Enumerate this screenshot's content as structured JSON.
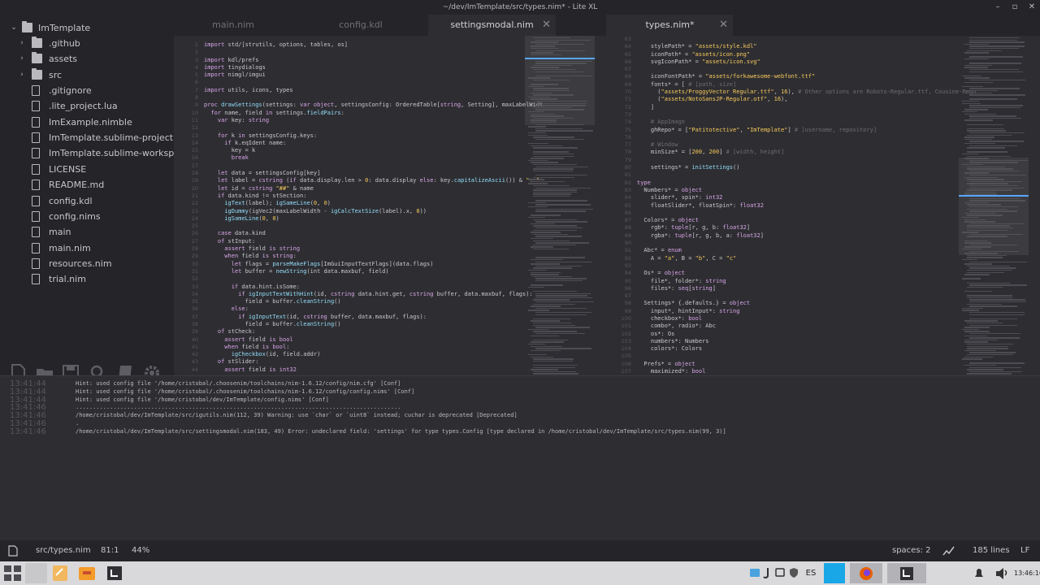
{
  "window": {
    "title": "~/dev/ImTemplate/src/types.nim* - Lite XL"
  },
  "sidebar": {
    "project": "ImTemplate",
    "items": [
      {
        "label": ".github",
        "type": "folder"
      },
      {
        "label": "assets",
        "type": "folder"
      },
      {
        "label": "src",
        "type": "folder"
      },
      {
        "label": ".gitignore",
        "type": "file"
      },
      {
        "label": ".lite_project.lua",
        "type": "file"
      },
      {
        "label": "ImExample.nimble",
        "type": "file"
      },
      {
        "label": "ImTemplate.sublime-project",
        "type": "file"
      },
      {
        "label": "ImTemplate.sublime-workspace",
        "type": "file"
      },
      {
        "label": "LICENSE",
        "type": "file"
      },
      {
        "label": "README.md",
        "type": "file"
      },
      {
        "label": "config.kdl",
        "type": "file"
      },
      {
        "label": "config.nims",
        "type": "file"
      },
      {
        "label": "main",
        "type": "file"
      },
      {
        "label": "main.nim",
        "type": "file"
      },
      {
        "label": "resources.nim",
        "type": "file"
      },
      {
        "label": "trial.nim",
        "type": "file"
      }
    ],
    "tools": [
      "new-file-icon",
      "open-folder-icon",
      "save-icon",
      "search-icon",
      "book-icon",
      "gear-icon"
    ]
  },
  "left_pane": {
    "tabs": [
      {
        "label": "main.nim",
        "active": false
      },
      {
        "label": "config.kdl",
        "active": false
      },
      {
        "label": "settingsmodal.nim",
        "active": true
      }
    ],
    "lines": [
      {
        "n": "1",
        "t": "import std/[strutils, options, tables, os]"
      },
      {
        "n": "2",
        "t": ""
      },
      {
        "n": "3",
        "t": "import kdl/prefs"
      },
      {
        "n": "4",
        "t": "import tinydialogs"
      },
      {
        "n": "5",
        "t": "import nimgl/imgui"
      },
      {
        "n": "6",
        "t": ""
      },
      {
        "n": "7",
        "t": "import utils, icons, types"
      },
      {
        "n": "8",
        "t": ""
      },
      {
        "n": "9",
        "t": "proc drawSettings(settings: var object, settingsConfig: OrderedTable[string, Setting], maxLabelWidt"
      },
      {
        "n": "10",
        "t": "  for name, field in settings.fieldPairs:"
      },
      {
        "n": "11",
        "t": "    var key: string"
      },
      {
        "n": "12",
        "t": ""
      },
      {
        "n": "13",
        "t": "    for k in settingsConfig.keys:"
      },
      {
        "n": "14",
        "t": "      if k.eqIdent name:"
      },
      {
        "n": "15",
        "t": "        key = k"
      },
      {
        "n": "16",
        "t": "        break"
      },
      {
        "n": "17",
        "t": ""
      },
      {
        "n": "18",
        "t": "    let data = settingsConfig[key]"
      },
      {
        "n": "19",
        "t": "    let label = cstring (if data.display.len > 0: data.display else: key.capitalizeAscii()) & \": \""
      },
      {
        "n": "20",
        "t": "    let id = cstring \"##\" & name"
      },
      {
        "n": "21",
        "t": "    if data.kind != stSection:"
      },
      {
        "n": "22",
        "t": "      igText(label); igSameLine(0, 0)"
      },
      {
        "n": "23",
        "t": "      igDummy(igVec2(maxLabelWidth - igCalcTextSize(label).x, 0))"
      },
      {
        "n": "24",
        "t": "      igSameLine(0, 0)"
      },
      {
        "n": "25",
        "t": ""
      },
      {
        "n": "26",
        "t": "    case data.kind"
      },
      {
        "n": "27",
        "t": "    of stInput:"
      },
      {
        "n": "28",
        "t": "      assert field is string"
      },
      {
        "n": "29",
        "t": "      when field is string:"
      },
      {
        "n": "30",
        "t": "        let flags = parseMakeFlags[ImGuiInputTextFlags](data.flags)"
      },
      {
        "n": "31",
        "t": "        let buffer = newString(int data.maxbuf, field)"
      },
      {
        "n": "32",
        "t": ""
      },
      {
        "n": "33",
        "t": "        if data.hint.isSome:"
      },
      {
        "n": "34",
        "t": "          if igInputTextWithHint(id, cstring data.hint.get, cstring buffer, data.maxbuf, flags):"
      },
      {
        "n": "35",
        "t": "            field = buffer.cleanString()"
      },
      {
        "n": "36",
        "t": "        else:"
      },
      {
        "n": "37",
        "t": "          if igInputText(id, cstring buffer, data.maxbuf, flags):"
      },
      {
        "n": "38",
        "t": "            field = buffer.cleanString()"
      },
      {
        "n": "39",
        "t": "    of stCheck:"
      },
      {
        "n": "40",
        "t": "      assert field is bool"
      },
      {
        "n": "41",
        "t": "      when field is bool:"
      },
      {
        "n": "42",
        "t": "        igCheckbox(id, field.addr)"
      },
      {
        "n": "43",
        "t": "    of stSlider:"
      },
      {
        "n": "44",
        "t": "      assert field is int32"
      }
    ]
  },
  "right_pane": {
    "tabs": [
      {
        "label": "types.nim*",
        "active": true
      }
    ],
    "lines": [
      {
        "n": "63",
        "t": ""
      },
      {
        "n": "64",
        "t": "    stylePath* = \"assets/style.kdl\""
      },
      {
        "n": "65",
        "t": "    iconPath* = \"assets/icon.png\""
      },
      {
        "n": "66",
        "t": "    svgIconPath* = \"assets/icon.svg\""
      },
      {
        "n": "67",
        "t": ""
      },
      {
        "n": "68",
        "t": "    iconFontPath* = \"assets/forkawesome-webfont.ttf\""
      },
      {
        "n": "69",
        "t": "    fonts* = [ # [path, size]"
      },
      {
        "n": "70",
        "t": "      (\"assets/ProggyVector Regular.ttf\", 16), # Other options are Roboto-Regular.ttf, Cousine-Regu"
      },
      {
        "n": "71",
        "t": "      (\"assets/NotoSansJP-Regular.otf\", 16),"
      },
      {
        "n": "72",
        "t": "    ]"
      },
      {
        "n": "73",
        "t": ""
      },
      {
        "n": "74",
        "t": "    # AppImage"
      },
      {
        "n": "75",
        "t": "    ghRepo* = [\"Patitotective\", \"ImTemplate\"] # [username, repository]"
      },
      {
        "n": "76",
        "t": ""
      },
      {
        "n": "77",
        "t": "    # Window"
      },
      {
        "n": "78",
        "t": "    minSize* = [200, 200] # [width, height]"
      },
      {
        "n": "79",
        "t": ""
      },
      {
        "n": "80",
        "t": "    settings* = initSettings()"
      },
      {
        "n": "81",
        "t": ""
      },
      {
        "n": "82",
        "t": "type"
      },
      {
        "n": "83",
        "t": "  Numbers* = object"
      },
      {
        "n": "84",
        "t": "    slider*, spin*: int32"
      },
      {
        "n": "85",
        "t": "    floatSlider*, floatSpin*: float32"
      },
      {
        "n": "86",
        "t": ""
      },
      {
        "n": "87",
        "t": "  Colors* = object"
      },
      {
        "n": "88",
        "t": "    rgb*: tuple[r, g, b: float32]"
      },
      {
        "n": "89",
        "t": "    rgba*: tuple[r, g, b, a: float32]"
      },
      {
        "n": "90",
        "t": ""
      },
      {
        "n": "91",
        "t": "  Abc* = enum"
      },
      {
        "n": "92",
        "t": "    A = \"a\", B = \"b\", C = \"c\""
      },
      {
        "n": "93",
        "t": ""
      },
      {
        "n": "94",
        "t": "  Os* = object"
      },
      {
        "n": "95",
        "t": "    file*, folder*: string"
      },
      {
        "n": "96",
        "t": "    files*: seq[string]"
      },
      {
        "n": "97",
        "t": ""
      },
      {
        "n": "98",
        "t": "  Settings* {.defaults.} = object"
      },
      {
        "n": "99",
        "t": "    input*, hintInput*: string"
      },
      {
        "n": "100",
        "t": "    checkbox*: bool"
      },
      {
        "n": "101",
        "t": "    combo*, radio*: Abc"
      },
      {
        "n": "102",
        "t": "    os*: Os"
      },
      {
        "n": "103",
        "t": "    numbers*: Numbers"
      },
      {
        "n": "104",
        "t": "    colors*: Colors"
      },
      {
        "n": "105",
        "t": ""
      },
      {
        "n": "106",
        "t": "  Prefs* = object"
      },
      {
        "n": "107",
        "t": "    maximized*: bool"
      }
    ]
  },
  "console": {
    "rows": [
      {
        "ts": "13:41:44",
        "msg": "Hint: used config file '/home/cristobal/.choosenim/toolchains/nim-1.6.12/config/nim.cfg' [Conf]"
      },
      {
        "ts": "13:41:44",
        "msg": "Hint: used config file '/home/cristobal/.choosenim/toolchains/nim-1.6.12/config/config.nims' [Conf]"
      },
      {
        "ts": "13:41:44",
        "msg": "Hint: used config file '/home/cristobal/dev/ImTemplate/config.nims' [Conf]"
      },
      {
        "ts": "13:41:46",
        "msg": "..............................................................................................."
      },
      {
        "ts": "13:41:46",
        "msg": "/home/cristobal/dev/ImTemplate/src/igutils.nim(112, 39) Warning: use `char` or `uint8` instead; cuchar is deprecated [Deprecated]"
      },
      {
        "ts": "13:41:46",
        "msg": "."
      },
      {
        "ts": "13:41:46",
        "msg": "/home/cristobal/dev/ImTemplate/src/settingsmodal.nim(183, 49) Error: undeclared field: 'settings' for type types.Config [type declared in /home/cristobal/dev/ImTemplate/src/types.nim(99, 3)]"
      }
    ]
  },
  "status": {
    "file": "src/types.nim",
    "position": "81:1",
    "percent": "44%",
    "indent": "spaces: 2",
    "lines": "185 lines",
    "eol": "LF"
  },
  "taskbar": {
    "lang": "ES",
    "clock": "13:46:16"
  }
}
